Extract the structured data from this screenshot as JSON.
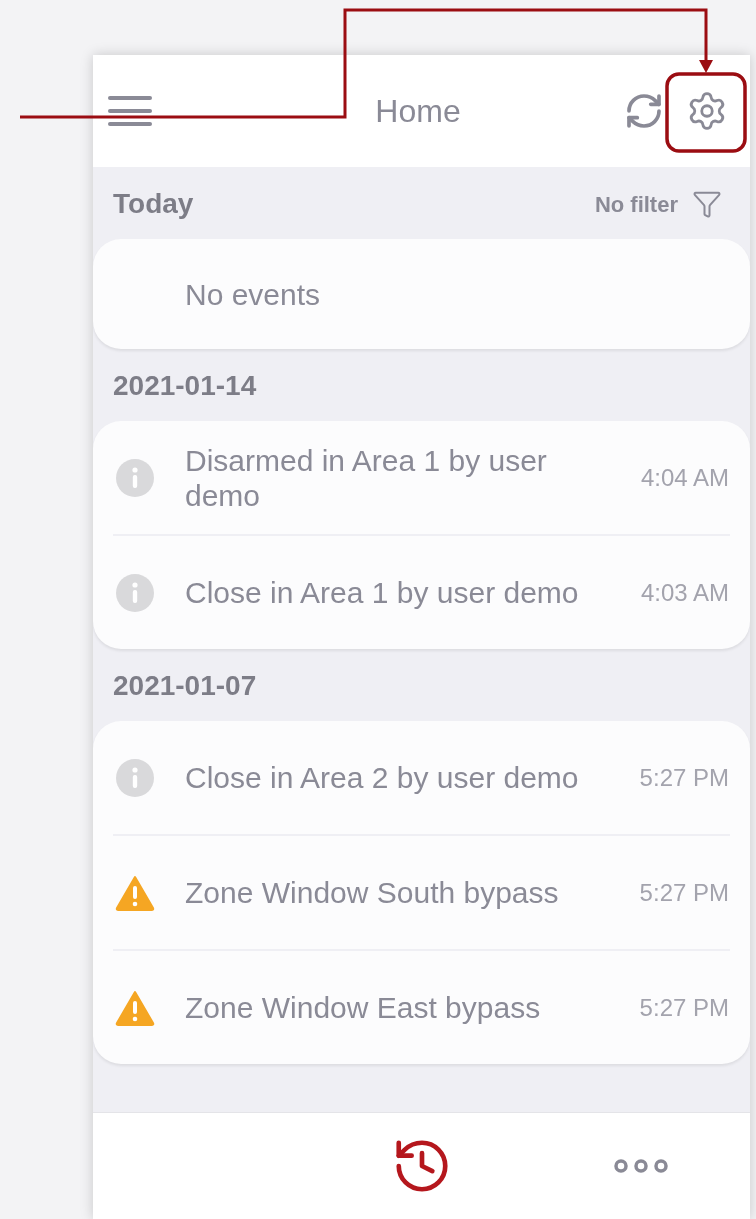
{
  "header": {
    "title": "Home"
  },
  "filter": {
    "label": "No filter"
  },
  "sections": [
    {
      "title": "Today",
      "empty_text": "No events"
    },
    {
      "title": "2021-01-14",
      "events": [
        {
          "kind": "info",
          "text": "Disarmed in Area 1 by user demo",
          "time": "4:04 AM"
        },
        {
          "kind": "info",
          "text": "Close in Area 1 by user demo",
          "time": "4:03 AM"
        }
      ]
    },
    {
      "title": "2021-01-07",
      "events": [
        {
          "kind": "info",
          "text": "Close in Area 2 by user demo",
          "time": "5:27 PM"
        },
        {
          "kind": "warning",
          "text": "Zone Window South bypass",
          "time": "5:27 PM"
        },
        {
          "kind": "warning",
          "text": "Zone Window East bypass",
          "time": "5:27 PM"
        }
      ]
    }
  ],
  "bottom_nav": [
    {
      "kind": "history",
      "selected": true
    },
    {
      "kind": "more",
      "selected": false
    }
  ]
}
